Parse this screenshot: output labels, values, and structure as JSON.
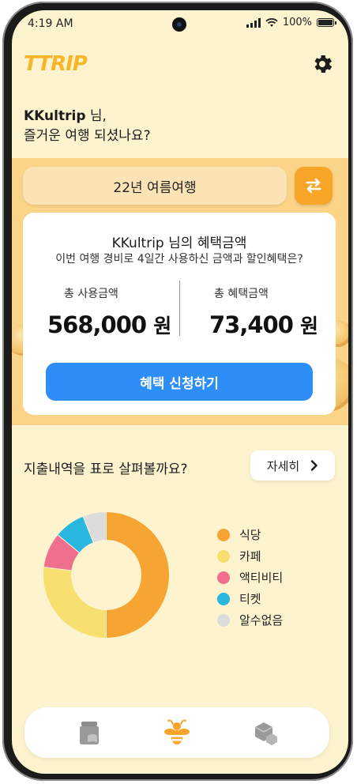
{
  "status_bar": {
    "time": "4:19 AM",
    "battery": "100%"
  },
  "header": {
    "logo": "TTRIP"
  },
  "greeting": {
    "name": "KKultrip",
    "suffix": " 님,",
    "line2": "즐거운 여행 되셨나요?"
  },
  "trip": {
    "selected": "22년 여름여행"
  },
  "benefit_card": {
    "title": "KKultrip 님의 혜택금액",
    "subtitle": "이번 여행 경비로 4일간 사용하신 금액과 할인혜택은?",
    "total_spent_label": "총 사용금액",
    "total_spent_value": "568,000",
    "total_benefit_label": "총 혜택금액",
    "total_benefit_value": "73,400",
    "currency_unit": "원",
    "apply_button": "혜택 신청하기"
  },
  "expenses": {
    "title": "지출내역을 표로 살펴볼까요?",
    "detail_button": "자세히"
  },
  "chart_data": {
    "type": "pie",
    "categories": [
      "식당",
      "카페",
      "액티비티",
      "티켓",
      "알수없음"
    ],
    "values": [
      50,
      27,
      9,
      8,
      6
    ],
    "colors": [
      "#f6a533",
      "#f7e06f",
      "#ef6f8d",
      "#29b6df",
      "#dcdcdc"
    ]
  },
  "bottom_nav": {
    "items": [
      "jar-icon",
      "bee-icon",
      "box-icon"
    ]
  },
  "colors": {
    "accent_orange": "#f7a629",
    "primary_blue": "#2c8ef6",
    "background": "#fdf3cf",
    "band": "#fbd488"
  }
}
